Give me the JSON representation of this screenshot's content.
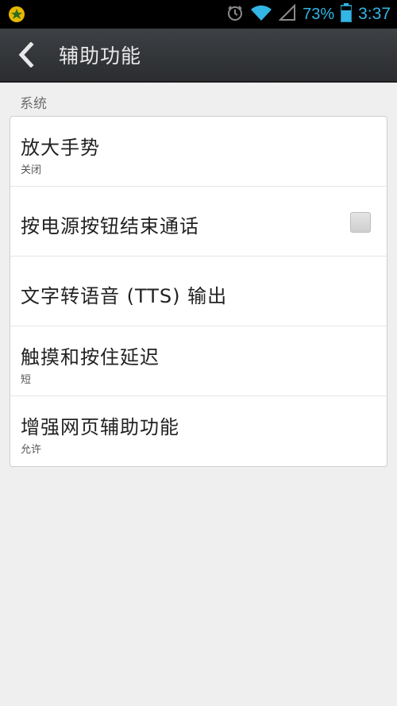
{
  "status_bar": {
    "battery_percent": "73%",
    "time": "3:37",
    "icons": [
      "notification-app-icon",
      "alarm-icon",
      "wifi-icon",
      "signal-icon",
      "battery-icon"
    ]
  },
  "header": {
    "title": "辅助功能",
    "back_icon": "chevron-left-icon"
  },
  "section": {
    "label": "系统",
    "items": [
      {
        "title": "放大手势",
        "summary": "关闭"
      },
      {
        "title": "按电源按钮结束通话",
        "checked": false
      },
      {
        "title": "文字转语音 (TTS) 输出"
      },
      {
        "title": "触摸和按住延迟",
        "summary": "短"
      },
      {
        "title": "增强网页辅助功能",
        "summary": "允许"
      }
    ]
  },
  "colors": {
    "status_accent": "#33b5e5",
    "background": "#efefef",
    "actionbar": "#34373a"
  }
}
